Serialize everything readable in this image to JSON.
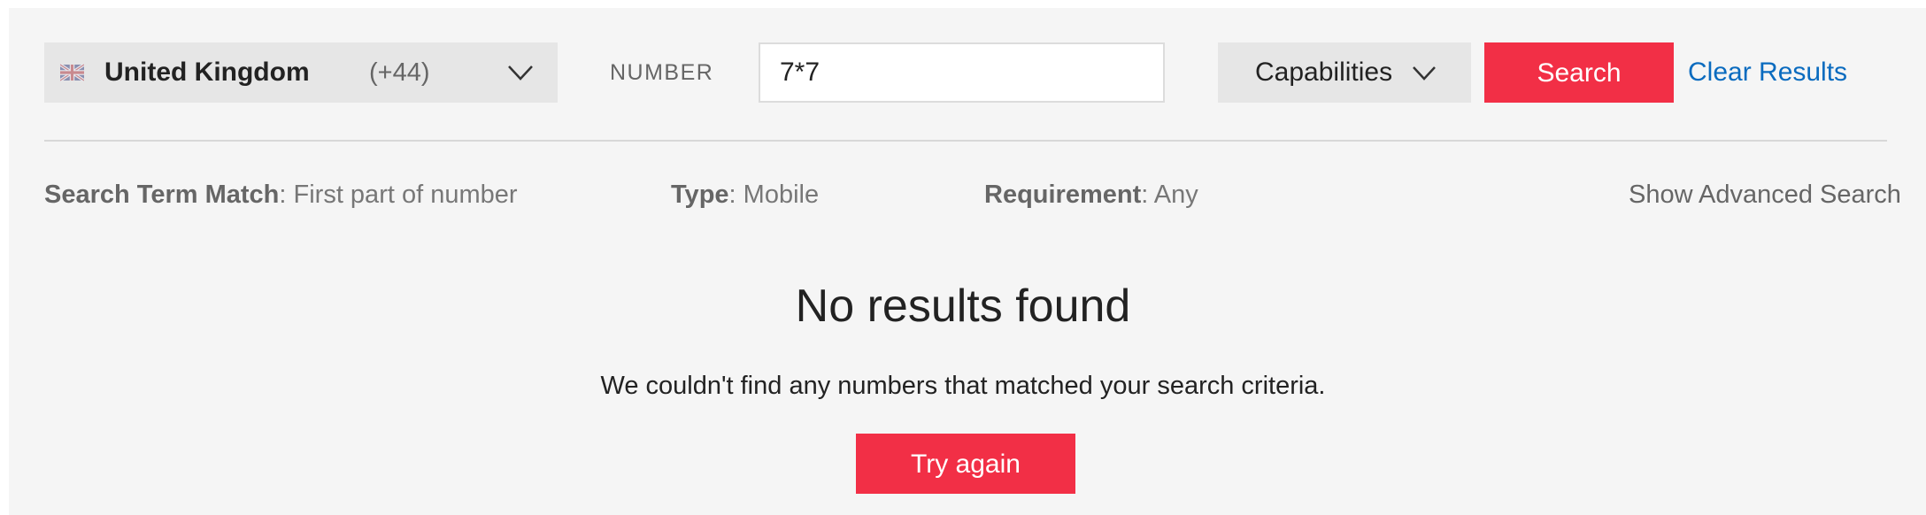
{
  "search_bar": {
    "country": {
      "flag_icon": "uk-flag-icon",
      "name": "United Kingdom",
      "code": "(+44)",
      "chevron_icon": "chevron-down-icon"
    },
    "number_label": "NUMBER",
    "number_value": "7*7",
    "capabilities_label": "Capabilities",
    "capabilities_icon": "chevron-down-icon",
    "search_label": "Search",
    "clear_label": "Clear Results"
  },
  "filters": {
    "match": {
      "label": "Search Term Match",
      "value": ": First part of number"
    },
    "type": {
      "label": "Type",
      "value": ": Mobile"
    },
    "requirement": {
      "label": "Requirement",
      "value": ": Any"
    },
    "advanced_label": "Show Advanced Search"
  },
  "results": {
    "title": "No results found",
    "message": "We couldn't find any numbers that matched your search criteria.",
    "try_again_label": "Try again"
  },
  "colors": {
    "accent": "#f22f46",
    "link": "#0a6bbf",
    "panel_bg": "#f5f5f5"
  }
}
